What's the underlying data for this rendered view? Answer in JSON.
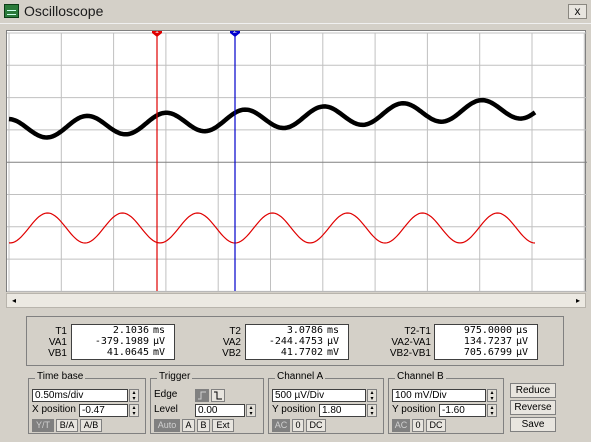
{
  "window": {
    "title": "Oscilloscope",
    "close_label": "x"
  },
  "scope": {
    "grid_color": "#c0c0c0",
    "channel_a_color": "#000000",
    "channel_b_color": "#e00000",
    "cursor1": {
      "label": "1",
      "color": "#e00000"
    },
    "cursor2": {
      "label": "2",
      "color": "#0000cc"
    }
  },
  "scrollbar": {
    "left_label": "◂",
    "right_label": "▸"
  },
  "readouts": {
    "t1": {
      "label": "T1",
      "value": "2.1036",
      "unit": "ms"
    },
    "va1": {
      "label": "VA1",
      "value": "-379.1989",
      "unit": "µV"
    },
    "vb1": {
      "label": "VB1",
      "value": "41.0645",
      "unit": "mV"
    },
    "t2": {
      "label": "T2",
      "value": "3.0786",
      "unit": "ms"
    },
    "va2": {
      "label": "VA2",
      "value": "-244.4753",
      "unit": "µV"
    },
    "vb2": {
      "label": "VB2",
      "value": "41.7702",
      "unit": "mV"
    },
    "t21": {
      "label": "T2-T1",
      "value": "975.0000",
      "unit": "µs"
    },
    "va21": {
      "label": "VA2-VA1",
      "value": "134.7237",
      "unit": "µV"
    },
    "vb21": {
      "label": "VB2-VB1",
      "value": "705.6799",
      "unit": "µV"
    }
  },
  "timebase": {
    "title": "Time base",
    "scale": "0.50ms/div",
    "xpos_label": "X position",
    "xpos": "-0.47",
    "buttons": [
      "Y/T",
      "B/A",
      "A/B"
    ]
  },
  "trigger": {
    "title": "Trigger",
    "edge_label": "Edge",
    "level_label": "Level",
    "level": "0.00",
    "buttons": [
      "Auto",
      "A",
      "B",
      "Ext"
    ]
  },
  "channel_a": {
    "title": "Channel A",
    "scale": "500 µV/Div",
    "ypos_label": "Y position",
    "ypos": "1.80",
    "buttons": [
      "AC",
      "0",
      "DC"
    ]
  },
  "channel_b": {
    "title": "Channel B",
    "scale": "100 mV/Div",
    "ypos_label": "Y position",
    "ypos": "-1.60",
    "buttons": [
      "AC",
      "0",
      "DC"
    ]
  },
  "actions": {
    "reduce": "Reduce",
    "reverse": "Reverse",
    "save": "Save"
  }
}
